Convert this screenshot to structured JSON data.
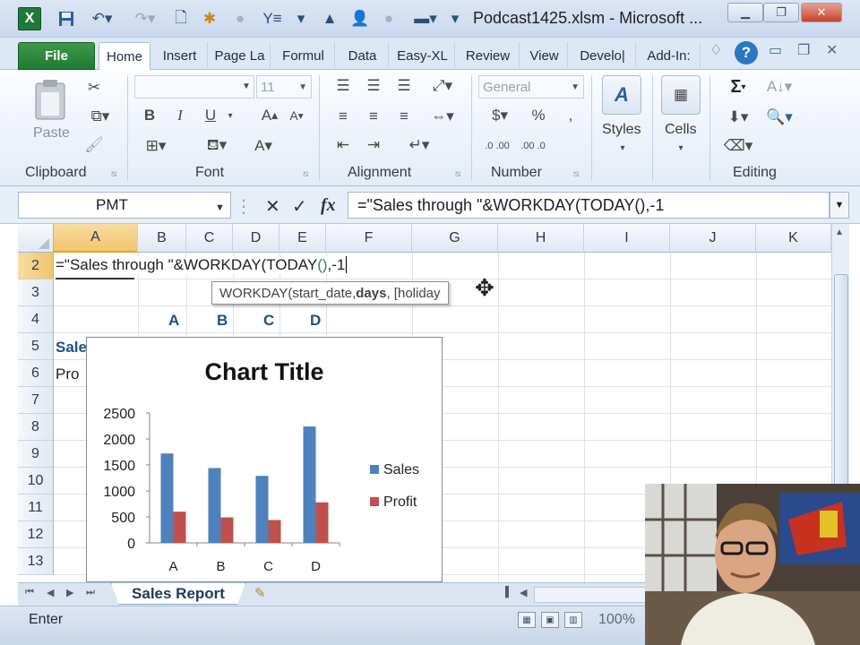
{
  "window": {
    "title": "Podcast1425.xlsm - Microsoft ...",
    "app_logo": "X",
    "controls": [
      "minimize-icon",
      "restore-icon",
      "close-icon"
    ]
  },
  "tabs": {
    "file": "File",
    "home": "Home",
    "insert": "Insert",
    "page_layout": "Page La",
    "formulas": "Formul",
    "data": "Data",
    "easy_xl": "Easy-XL",
    "review": "Review",
    "view": "View",
    "developer": "Develo|",
    "addins": "Add-In:"
  },
  "ribbon": {
    "clipboard": {
      "label": "Clipboard",
      "paste": "Paste"
    },
    "font": {
      "label": "Font",
      "font_name": "",
      "font_size": "11",
      "bold": "B",
      "italic": "I",
      "underline": "U"
    },
    "alignment": {
      "label": "Alignment"
    },
    "number": {
      "label": "Number",
      "format": "General",
      "currency": "$",
      "percent": "%",
      "inc_dec": ".0 .00",
      "dec_dec": ".00 .0"
    },
    "styles": {
      "label": "Styles"
    },
    "cells": {
      "label": "Cells"
    },
    "editing": {
      "label": "Editing",
      "sum": "Σ"
    }
  },
  "formula_bar": {
    "name_box": "PMT",
    "cancel": "✕",
    "enter": "✓",
    "fx": "fx",
    "formula": "=\"Sales through \"&WORKDAY(TODAY(),-1"
  },
  "grid": {
    "columns": [
      "A",
      "B",
      "C",
      "D",
      "E",
      "F",
      "G",
      "H",
      "I",
      "J",
      "K"
    ],
    "rows": [
      "2",
      "3",
      "4",
      "5",
      "6",
      "7",
      "8",
      "9",
      "10",
      "11",
      "12",
      "13"
    ],
    "cells": {
      "A2_part1": "=\"Sales through \"&WORKDAY(TODAY",
      "A2_paren": "()",
      "A2_part2": ",-1",
      "B4": "A",
      "C4": "B",
      "D4": "C",
      "E4": "D",
      "A5": "Sale",
      "A6": "Pro"
    },
    "tooltip": {
      "func": "WORKDAY(start_date, ",
      "bold": "days",
      "rest": ", [holiday"
    }
  },
  "chart_data": {
    "type": "bar",
    "title": "Chart Title",
    "categories": [
      "A",
      "B",
      "C",
      "D"
    ],
    "series": [
      {
        "name": "Sales",
        "values": [
          1720,
          1440,
          1290,
          2240
        ],
        "color": "#4f81bd"
      },
      {
        "name": "Profit",
        "values": [
          600,
          490,
          440,
          780
        ],
        "color": "#c0504d"
      }
    ],
    "yticks": [
      "0",
      "500",
      "1000",
      "1500",
      "2000",
      "2500"
    ],
    "ylim": [
      0,
      2500
    ],
    "legend": "right",
    "grid": false
  },
  "sheets": {
    "active": "Sales Report"
  },
  "status": {
    "mode": "Enter",
    "zoom": "100%"
  }
}
